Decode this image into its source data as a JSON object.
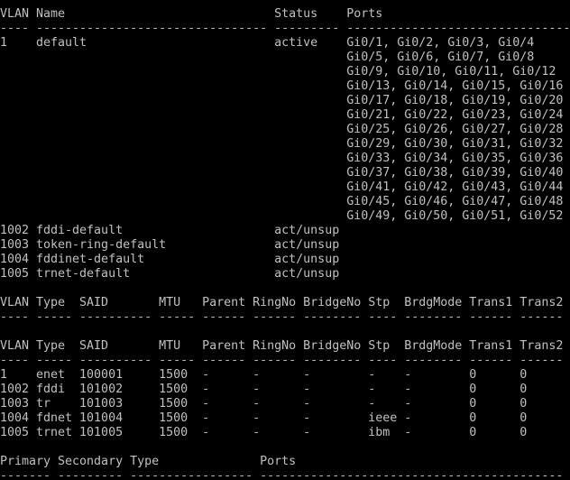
{
  "terminal": {
    "lines": [
      "VLAN Name                             Status    Ports",
      "---- -------------------------------- --------- -------------------------------",
      "1    default                          active    Gi0/1, Gi0/2, Gi0/3, Gi0/4",
      "                                                Gi0/5, Gi0/6, Gi0/7, Gi0/8",
      "                                                Gi0/9, Gi0/10, Gi0/11, Gi0/12",
      "                                                Gi0/13, Gi0/14, Gi0/15, Gi0/16",
      "                                                Gi0/17, Gi0/18, Gi0/19, Gi0/20",
      "                                                Gi0/21, Gi0/22, Gi0/23, Gi0/24",
      "                                                Gi0/25, Gi0/26, Gi0/27, Gi0/28",
      "                                                Gi0/29, Gi0/30, Gi0/31, Gi0/32",
      "                                                Gi0/33, Gi0/34, Gi0/35, Gi0/36",
      "                                                Gi0/37, Gi0/38, Gi0/39, Gi0/40",
      "                                                Gi0/41, Gi0/42, Gi0/43, Gi0/44",
      "                                                Gi0/45, Gi0/46, Gi0/47, Gi0/48",
      "                                                Gi0/49, Gi0/50, Gi0/51, Gi0/52",
      "1002 fddi-default                     act/unsup",
      "1003 token-ring-default               act/unsup",
      "1004 fddinet-default                  act/unsup",
      "1005 trnet-default                    act/unsup",
      "",
      "VLAN Type  SAID       MTU   Parent RingNo BridgeNo Stp  BrdgMode Trans1 Trans2",
      "---- ----- ---------- ----- ------ ------ -------- ---- -------- ------ ------",
      "",
      "VLAN Type  SAID       MTU   Parent RingNo BridgeNo Stp  BrdgMode Trans1 Trans2",
      "---- ----- ---------- ----- ------ ------ -------- ---- -------- ------ ------",
      "1    enet  100001     1500  -      -      -        -    -        0      0",
      "1002 fddi  101002     1500  -      -      -        -    -        0      0",
      "1003 tr    101003     1500  -      -      -        -    -        0      0",
      "1004 fdnet 101004     1500  -      -      -        ieee -        0      0",
      "1005 trnet 101005     1500  -      -      -        ibm  -        0      0",
      "",
      "Primary Secondary Type              Ports",
      "------- --------- ----------------- ------------------------------------------"
    ]
  }
}
